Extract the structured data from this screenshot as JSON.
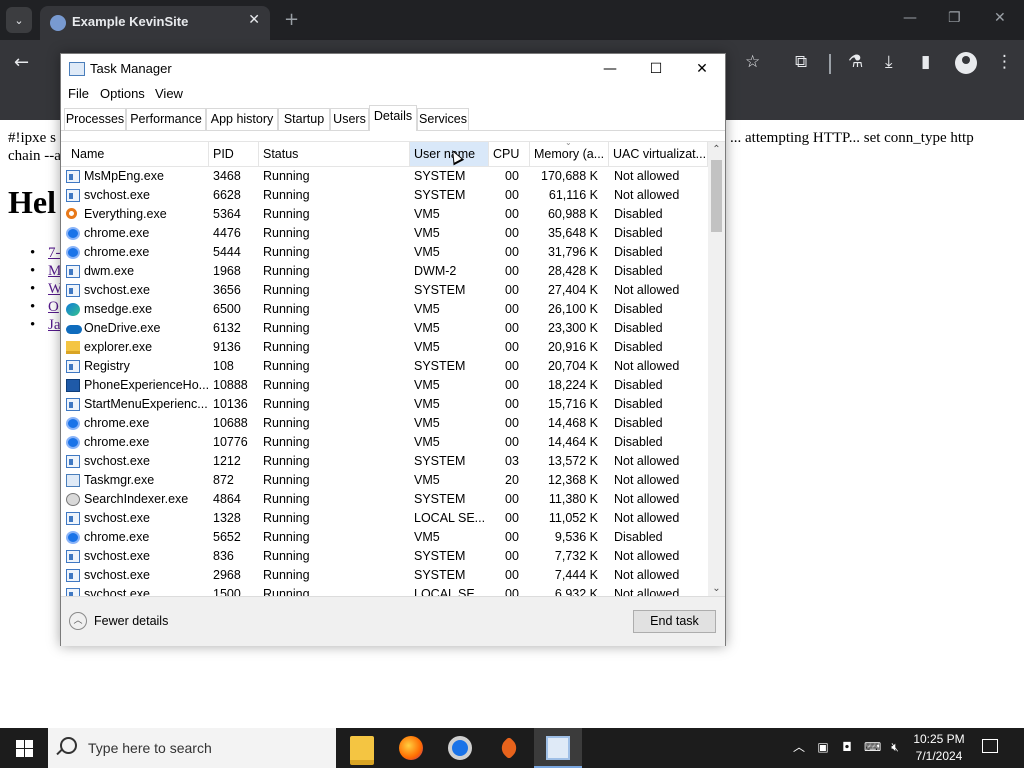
{
  "browser": {
    "tab_title": "Example KevinSite",
    "tab_close": "✕",
    "new_tab": "+",
    "window_controls": {
      "minimize": "—",
      "restore": "❐",
      "close": "✕"
    },
    "back": "←"
  },
  "webpage": {
    "line1_left": "#!ipxe s",
    "line1_right": "... attempting HTTP... set conn_type http",
    "line2": "chain --a",
    "heading": "Hel",
    "links": [
      "7-",
      "M",
      "W",
      "O",
      "Ja"
    ]
  },
  "taskmanager": {
    "title": "Task Manager",
    "window_controls": {
      "minimize": "—",
      "maximize": "☐",
      "close": "✕"
    },
    "menu": [
      "File",
      "Options",
      "View"
    ],
    "tabs": [
      "Processes",
      "Performance",
      "App history",
      "Startup",
      "Users",
      "Details",
      "Services"
    ],
    "active_tab": "Details",
    "columns": [
      "Name",
      "PID",
      "Status",
      "User name",
      "CPU",
      "Memory (a...",
      "UAC virtualizat..."
    ],
    "sorted_column": "Memory (a...",
    "rows": [
      {
        "icon": "window",
        "name": "MsMpEng.exe",
        "pid": "3468",
        "status": "Running",
        "user": "SYSTEM",
        "cpu": "00",
        "mem": "170,688 K",
        "uac": "Not allowed"
      },
      {
        "icon": "window",
        "name": "svchost.exe",
        "pid": "6628",
        "status": "Running",
        "user": "SYSTEM",
        "cpu": "00",
        "mem": "61,116 K",
        "uac": "Not allowed"
      },
      {
        "icon": "search",
        "name": "Everything.exe",
        "pid": "5364",
        "status": "Running",
        "user": "VM5",
        "cpu": "00",
        "mem": "60,988 K",
        "uac": "Disabled"
      },
      {
        "icon": "chrome",
        "name": "chrome.exe",
        "pid": "4476",
        "status": "Running",
        "user": "VM5",
        "cpu": "00",
        "mem": "35,648 K",
        "uac": "Disabled"
      },
      {
        "icon": "chrome",
        "name": "chrome.exe",
        "pid": "5444",
        "status": "Running",
        "user": "VM5",
        "cpu": "00",
        "mem": "31,796 K",
        "uac": "Disabled"
      },
      {
        "icon": "window",
        "name": "dwm.exe",
        "pid": "1968",
        "status": "Running",
        "user": "DWM-2",
        "cpu": "00",
        "mem": "28,428 K",
        "uac": "Disabled"
      },
      {
        "icon": "window",
        "name": "svchost.exe",
        "pid": "3656",
        "status": "Running",
        "user": "SYSTEM",
        "cpu": "00",
        "mem": "27,404 K",
        "uac": "Not allowed"
      },
      {
        "icon": "edge",
        "name": "msedge.exe",
        "pid": "6500",
        "status": "Running",
        "user": "VM5",
        "cpu": "00",
        "mem": "26,100 K",
        "uac": "Disabled"
      },
      {
        "icon": "onedrive",
        "name": "OneDrive.exe",
        "pid": "6132",
        "status": "Running",
        "user": "VM5",
        "cpu": "00",
        "mem": "23,300 K",
        "uac": "Disabled"
      },
      {
        "icon": "folder",
        "name": "explorer.exe",
        "pid": "9136",
        "status": "Running",
        "user": "VM5",
        "cpu": "00",
        "mem": "20,916 K",
        "uac": "Disabled"
      },
      {
        "icon": "window",
        "name": "Registry",
        "pid": "108",
        "status": "Running",
        "user": "SYSTEM",
        "cpu": "00",
        "mem": "20,704 K",
        "uac": "Not allowed"
      },
      {
        "icon": "phone",
        "name": "PhoneExperienceHo...",
        "pid": "10888",
        "status": "Running",
        "user": "VM5",
        "cpu": "00",
        "mem": "18,224 K",
        "uac": "Disabled"
      },
      {
        "icon": "window",
        "name": "StartMenuExperienc...",
        "pid": "10136",
        "status": "Running",
        "user": "VM5",
        "cpu": "00",
        "mem": "15,716 K",
        "uac": "Disabled"
      },
      {
        "icon": "chrome",
        "name": "chrome.exe",
        "pid": "10688",
        "status": "Running",
        "user": "VM5",
        "cpu": "00",
        "mem": "14,468 K",
        "uac": "Disabled"
      },
      {
        "icon": "chrome",
        "name": "chrome.exe",
        "pid": "10776",
        "status": "Running",
        "user": "VM5",
        "cpu": "00",
        "mem": "14,464 K",
        "uac": "Disabled"
      },
      {
        "icon": "window",
        "name": "svchost.exe",
        "pid": "1212",
        "status": "Running",
        "user": "SYSTEM",
        "cpu": "03",
        "mem": "13,572 K",
        "uac": "Not allowed"
      },
      {
        "icon": "tm",
        "name": "Taskmgr.exe",
        "pid": "872",
        "status": "Running",
        "user": "VM5",
        "cpu": "20",
        "mem": "12,368 K",
        "uac": "Not allowed"
      },
      {
        "icon": "indexer",
        "name": "SearchIndexer.exe",
        "pid": "4864",
        "status": "Running",
        "user": "SYSTEM",
        "cpu": "00",
        "mem": "11,380 K",
        "uac": "Not allowed"
      },
      {
        "icon": "window",
        "name": "svchost.exe",
        "pid": "1328",
        "status": "Running",
        "user": "LOCAL SE...",
        "cpu": "00",
        "mem": "11,052 K",
        "uac": "Not allowed"
      },
      {
        "icon": "chrome",
        "name": "chrome.exe",
        "pid": "5652",
        "status": "Running",
        "user": "VM5",
        "cpu": "00",
        "mem": "9,536 K",
        "uac": "Disabled"
      },
      {
        "icon": "window",
        "name": "svchost.exe",
        "pid": "836",
        "status": "Running",
        "user": "SYSTEM",
        "cpu": "00",
        "mem": "7,732 K",
        "uac": "Not allowed"
      },
      {
        "icon": "window",
        "name": "svchost.exe",
        "pid": "2968",
        "status": "Running",
        "user": "SYSTEM",
        "cpu": "00",
        "mem": "7,444 K",
        "uac": "Not allowed"
      },
      {
        "icon": "window",
        "name": "svchost.exe",
        "pid": "1500",
        "status": "Running",
        "user": "LOCAL SE...",
        "cpu": "00",
        "mem": "6,932 K",
        "uac": "Not allowed"
      }
    ],
    "fewer_details": "Fewer details",
    "end_task": "End task"
  },
  "taskbar": {
    "search_placeholder": "Type here to search",
    "apps": [
      "file-explorer",
      "firefox",
      "chrome",
      "feather-app",
      "task-manager"
    ],
    "active_app": "task-manager",
    "clock_time": "10:25 PM",
    "clock_date": "7/1/2024"
  },
  "colors": {
    "chrome_dark": "#202124",
    "chrome_toolbar": "#35363a",
    "sorted_header": "#d9e8f9",
    "taskbar": "#1c1c1c"
  }
}
